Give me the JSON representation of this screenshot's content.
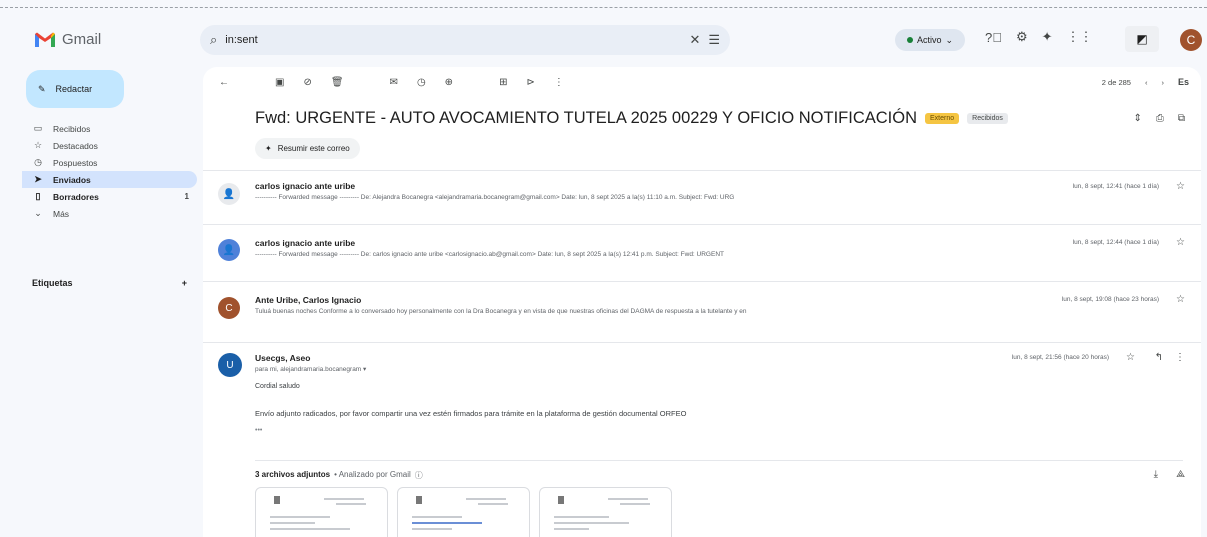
{
  "app": {
    "name": "Gmail"
  },
  "search": {
    "query": "in:sent"
  },
  "status": {
    "label": "Activo"
  },
  "user": {
    "initial": "C"
  },
  "sidebar": {
    "compose_label": "Redactar",
    "items": [
      {
        "label": "Recibidos",
        "icon": "inbox-icon",
        "glyph": "▭"
      },
      {
        "label": "Destacados",
        "icon": "star-icon",
        "glyph": "☆"
      },
      {
        "label": "Pospuestos",
        "icon": "clock-icon",
        "glyph": "◷"
      },
      {
        "label": "Enviados",
        "icon": "send-icon",
        "glyph": "➤"
      },
      {
        "label": "Borradores",
        "icon": "draft-icon",
        "glyph": "▯",
        "count": "1"
      },
      {
        "label": "Más",
        "icon": "chevron-down-icon",
        "glyph": "⌄"
      }
    ],
    "labels_title": "Etiquetas"
  },
  "toolbar": {
    "pager": "2 de 285",
    "lang": "Es"
  },
  "thread": {
    "subject": "Fwd: URGENTE - AUTO AVOCAMIENTO TUTELA 2025 00229 Y OFICIO NOTIFICACIÓN",
    "tag_external": "Externo",
    "tag_label": "Recibidos",
    "summarize_label": "Resumir este correo"
  },
  "messages": [
    {
      "from": "carlos ignacio ante uribe",
      "snippet": "---------- Forwarded message --------- De: Alejandra Bocanegra <alejandramaria.bocanegram@gmail.com> Date: lun, 8 sept 2025 a la(s) 11:10 a.m. Subject: Fwd: URG",
      "date": "lun, 8 sept, 12:41 (hace 1 día)",
      "avatar": "",
      "avatar_color": "#e8eaed"
    },
    {
      "from": "carlos ignacio ante uribe",
      "snippet": "---------- Forwarded message --------- De: carlos ignacio ante uribe <carlosignacio.ab@gmail.com> Date: lun, 8 sept 2025 a la(s) 12:41 p.m. Subject: Fwd: URGENT",
      "date": "lun, 8 sept, 12:44 (hace 1 día)",
      "avatar": "",
      "avatar_color": "#4f81d9"
    },
    {
      "from": "Ante Uribe, Carlos Ignacio",
      "snippet": "Tuluá buenas noches Conforme a lo conversado hoy personalmente con la Dra Bocanegra y en vista de que nuestras oficinas del DAGMA de respuesta a la tutelante y en",
      "date": "lun, 8 sept, 19:08 (hace 23 horas)",
      "avatar": "C",
      "avatar_color": "#a0522d"
    }
  ],
  "open_message": {
    "from": "Usecgs, Aseo",
    "to": "para mi, alejandramaria.bocanegram",
    "date": "lun, 8 sept, 21:56 (hace 20 horas)",
    "greeting": "Cordial saludo",
    "body": "Envío adjunto radicados, por favor compartir una vez estén firmados para trámite en la plataforma de gestión documental ORFEO",
    "ellipsis": "•••"
  },
  "attachments": {
    "title": "3 archivos adjuntos",
    "analyzed": "• Analizado por Gmail"
  },
  "colors": {
    "accent": "#c2e7ff",
    "active_nav": "#d3e3fd",
    "background": "#f6f8fc"
  }
}
